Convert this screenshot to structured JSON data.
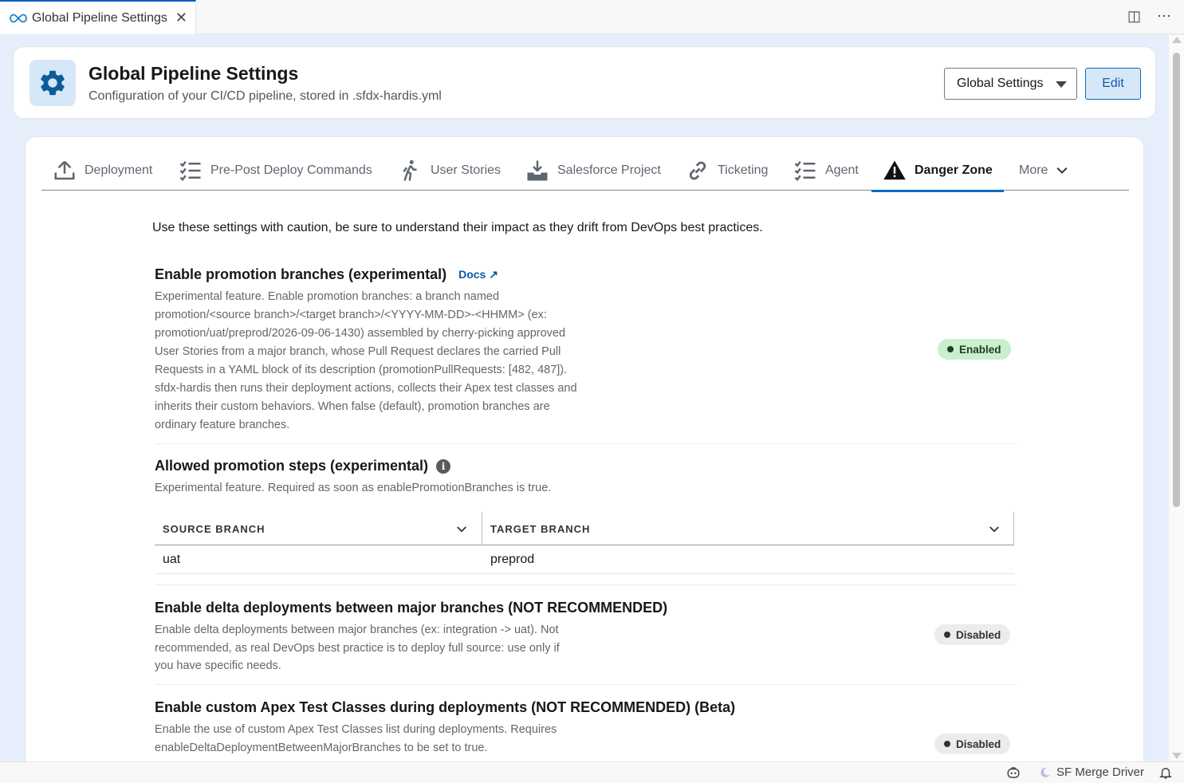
{
  "editor_tab": {
    "title": "Global Pipeline Settings"
  },
  "header": {
    "title": "Global Pipeline Settings",
    "subtitle": "Configuration of your CI/CD pipeline, stored in .sfdx-hardis.yml",
    "select_value": "Global Settings",
    "edit_label": "Edit"
  },
  "tabs": [
    {
      "label": "Deployment",
      "icon": "upload-icon"
    },
    {
      "label": "Pre-Post Deploy Commands",
      "icon": "checklist-icon"
    },
    {
      "label": "User Stories",
      "icon": "hiker-icon"
    },
    {
      "label": "Salesforce Project",
      "icon": "download-tray-icon"
    },
    {
      "label": "Ticketing",
      "icon": "link-icon"
    },
    {
      "label": "Agent",
      "icon": "checklist-icon"
    },
    {
      "label": "Danger Zone",
      "icon": "warning-icon",
      "active": true
    },
    {
      "label": "More",
      "icon": "chevron-down-icon"
    }
  ],
  "intro": "Use these settings with caution, be sure to understand their impact as they drift from DevOps best practices.",
  "settings": {
    "promotion": {
      "title": "Enable promotion branches (experimental)",
      "docs": "Docs ↗",
      "desc": "Experimental feature. Enable promotion branches: a branch named promotion/<source branch>/<target branch>/<YYYY-MM-DD>-<HHMM> (ex: promotion/uat/preprod/2026-09-06-1430) assembled by cherry-picking approved User Stories from a major branch, whose Pull Request declares the carried Pull Requests in a YAML block of its description (promotionPullRequests: [482, 487]). sfdx-hardis then runs their deployment actions, collects their Apex test classes and inherits their custom behaviors. When false (default), promotion branches are ordinary feature branches.",
      "status": "Enabled"
    },
    "steps": {
      "title": "Allowed promotion steps (experimental)",
      "info": "i",
      "desc": "Experimental feature. Required as soon as enablePromotionBranches is true.",
      "col_source": "SOURCE BRANCH",
      "col_target": "TARGET BRANCH",
      "rows": [
        {
          "source": "uat",
          "target": "preprod"
        }
      ]
    },
    "delta": {
      "title": "Enable delta deployments between major branches (NOT RECOMMENDED)",
      "desc": "Enable delta deployments between major branches (ex: integration -> uat). Not recommended, as real DevOps best practice is to deploy full source: use only if you have specific needs.",
      "status": "Disabled"
    },
    "apex": {
      "title": "Enable custom Apex Test Classes during deployments (NOT RECOMMENDED) (Beta)",
      "desc": "Enable the use of custom Apex Test Classes list during deployments. Requires enableDeltaDeploymentBetweenMajorBranches to be set to true.",
      "status": "Disabled"
    }
  },
  "statusbar": {
    "merge_driver": "SF Merge Driver"
  },
  "colors": {
    "accent": "#0a6ac2",
    "enabled_bg": "#c9efcf",
    "disabled_bg": "#ececec"
  }
}
